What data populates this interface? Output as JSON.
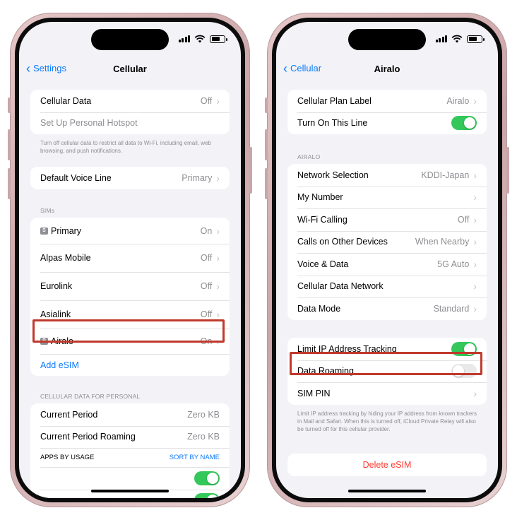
{
  "left": {
    "back_label": "Settings",
    "title": "Cellular",
    "top_group": [
      {
        "label": "Cellular Data",
        "value": "Off"
      },
      {
        "label": "Set Up Personal Hotspot"
      }
    ],
    "top_footnote": "Turn off cellular data to restrict all data to Wi-Fi, including email, web browsing, and push notifications.",
    "voice_line": {
      "label": "Default Voice Line",
      "value": "Primary"
    },
    "sims_header": "SIMs",
    "sims": [
      {
        "label": "Primary",
        "value": "On",
        "tag": "S"
      },
      {
        "label": "Alpas Mobile",
        "value": "Off"
      },
      {
        "label": "Eurolink",
        "value": "Off"
      },
      {
        "label": "Asialink",
        "value": "Off"
      },
      {
        "label": "Airalo",
        "value": "On",
        "tag": "P"
      }
    ],
    "add_esim": "Add eSIM",
    "usage_header": "CELLULAR DATA FOR PERSONAL",
    "usage": [
      {
        "label": "Current Period",
        "value": "Zero KB"
      },
      {
        "label": "Current Period Roaming",
        "value": "Zero KB"
      }
    ],
    "apps_by_usage": "APPS BY USAGE",
    "sort_by_name": "SORT BY NAME"
  },
  "right": {
    "back_label": "Cellular",
    "title": "Airalo",
    "plan_group": [
      {
        "label": "Cellular Plan Label",
        "value": "Airalo"
      },
      {
        "label": "Turn On This Line",
        "toggle": "on"
      }
    ],
    "airalo_header": "AIRALO",
    "settings": [
      {
        "label": "Network Selection",
        "value": "KDDI-Japan"
      },
      {
        "label": "My Number",
        "value": ""
      },
      {
        "label": "Wi-Fi Calling",
        "value": "Off"
      },
      {
        "label": "Calls on Other Devices",
        "value": "When Nearby"
      },
      {
        "label": "Voice & Data",
        "value": "5G Auto"
      },
      {
        "label": "Cellular Data Network",
        "value": ""
      },
      {
        "label": "Data Mode",
        "value": "Standard"
      }
    ],
    "privacy": [
      {
        "label": "Limit IP Address Tracking",
        "toggle": "on"
      },
      {
        "label": "Data Roaming",
        "toggle": "off"
      },
      {
        "label": "SIM PIN"
      }
    ],
    "privacy_footnote": "Limit IP address tracking by hiding your IP address from known trackers in Mail and Safari. When this is turned off, iCloud Private Relay will also be turned off for this cellular provider.",
    "delete_esim": "Delete eSIM"
  },
  "colors": {
    "accent": "#0a7aff",
    "toggle_on": "#34c759",
    "highlight": "#c0392b",
    "destructive": "#ff3b30",
    "frame": "#caa4a7"
  }
}
